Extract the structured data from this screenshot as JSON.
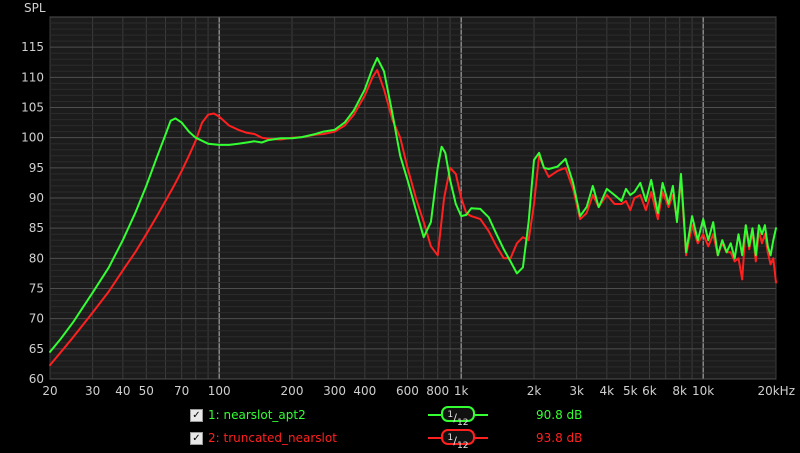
{
  "chart_data": {
    "type": "line",
    "ylabel": "SPL",
    "xlabel": "",
    "x_scale": "log",
    "xlim": [
      20,
      20000
    ],
    "ylim": [
      60,
      120
    ],
    "grid": true,
    "x_ticks": [
      {
        "value": 20,
        "label": "20"
      },
      {
        "value": 30,
        "label": "30"
      },
      {
        "value": 40,
        "label": "40"
      },
      {
        "value": 50,
        "label": "50"
      },
      {
        "value": 70,
        "label": "70"
      },
      {
        "value": 100,
        "label": "100"
      },
      {
        "value": 200,
        "label": "200"
      },
      {
        "value": 300,
        "label": "300"
      },
      {
        "value": 400,
        "label": "400"
      },
      {
        "value": 600,
        "label": "600"
      },
      {
        "value": 800,
        "label": "800"
      },
      {
        "value": 1000,
        "label": "1k"
      },
      {
        "value": 2000,
        "label": "2k"
      },
      {
        "value": 3000,
        "label": "3k"
      },
      {
        "value": 4000,
        "label": "4k"
      },
      {
        "value": 5000,
        "label": "5k"
      },
      {
        "value": 6000,
        "label": "6k"
      },
      {
        "value": 8000,
        "label": "8k"
      },
      {
        "value": 10000,
        "label": "10k"
      },
      {
        "value": 20000,
        "label": "20kHz"
      }
    ],
    "y_ticks": [
      60,
      65,
      70,
      75,
      80,
      85,
      90,
      95,
      100,
      105,
      110,
      115
    ],
    "series": [
      {
        "name": "1: nearslot_apt2",
        "color": "#33ff33",
        "x": [
          20,
          22,
          25,
          28,
          30,
          35,
          40,
          45,
          50,
          55,
          60,
          63,
          66,
          70,
          75,
          80,
          90,
          100,
          110,
          120,
          130,
          140,
          150,
          160,
          180,
          200,
          220,
          250,
          270,
          300,
          330,
          360,
          400,
          430,
          450,
          480,
          520,
          560,
          600,
          650,
          700,
          750,
          800,
          830,
          860,
          900,
          950,
          1000,
          1050,
          1100,
          1200,
          1300,
          1400,
          1500,
          1600,
          1700,
          1800,
          1900,
          2000,
          2100,
          2200,
          2300,
          2500,
          2700,
          2900,
          3100,
          3300,
          3500,
          3700,
          4000,
          4300,
          4600,
          4800,
          5000,
          5200,
          5500,
          5800,
          6100,
          6500,
          6800,
          7200,
          7500,
          7800,
          8100,
          8500,
          9000,
          9500,
          10000,
          10500,
          11000,
          11500,
          12000,
          12500,
          13000,
          13500,
          14000,
          14500,
          15000,
          15500,
          16000,
          16500,
          17000,
          17500,
          18000,
          18500,
          19000,
          19500,
          20000
        ],
        "y": [
          64.5,
          66.5,
          69.5,
          72.5,
          74.3,
          78.5,
          83,
          87.5,
          92,
          96.5,
          100.5,
          102.8,
          103.2,
          102.5,
          101,
          100,
          99,
          98.8,
          98.8,
          99,
          99.2,
          99.4,
          99.2,
          99.6,
          99.9,
          99.9,
          100.1,
          100.6,
          101,
          101.3,
          102.5,
          104.5,
          108,
          111.5,
          113.2,
          111,
          104,
          97,
          93,
          88,
          83.5,
          86,
          95,
          98.5,
          97.5,
          93,
          89,
          87,
          87.2,
          88.3,
          88.2,
          86.8,
          84,
          81.5,
          79.5,
          77.5,
          78.5,
          86,
          96.3,
          97.5,
          95,
          94.8,
          95.2,
          96.5,
          92.5,
          87,
          88.5,
          92,
          88.5,
          91.5,
          90.5,
          89.5,
          91.5,
          90.5,
          91,
          92.5,
          89.5,
          93,
          87.5,
          92.5,
          89,
          92,
          86,
          94,
          81,
          87,
          83,
          86.5,
          83,
          86,
          80.5,
          83,
          81,
          82.5,
          80,
          84,
          80.5,
          85.5,
          82,
          85,
          80.5,
          85.5,
          84,
          85.5,
          82,
          80.5,
          83,
          85
        ]
      },
      {
        "name": "2: truncated_nearslot",
        "color": "#ff2020",
        "x": [
          20,
          22,
          25,
          28,
          30,
          35,
          40,
          45,
          50,
          55,
          60,
          65,
          70,
          75,
          80,
          85,
          90,
          95,
          100,
          110,
          120,
          130,
          140,
          150,
          160,
          180,
          200,
          220,
          250,
          270,
          300,
          330,
          360,
          400,
          430,
          450,
          480,
          520,
          560,
          600,
          650,
          700,
          750,
          800,
          850,
          900,
          950,
          1000,
          1050,
          1100,
          1200,
          1300,
          1400,
          1500,
          1600,
          1700,
          1800,
          1900,
          2000,
          2100,
          2200,
          2300,
          2500,
          2700,
          2900,
          3100,
          3300,
          3500,
          3700,
          4000,
          4300,
          4600,
          4800,
          5000,
          5200,
          5500,
          5800,
          6100,
          6500,
          6800,
          7200,
          7500,
          7800,
          8100,
          8500,
          9000,
          9500,
          10000,
          10500,
          11000,
          11500,
          12000,
          12500,
          13000,
          13500,
          14000,
          14500,
          15000,
          15500,
          16000,
          16500,
          17000,
          17500,
          18000,
          18500,
          19000,
          19500,
          20000
        ],
        "y": [
          62.3,
          64.3,
          67,
          69.5,
          71,
          74.5,
          78,
          81,
          84,
          86.8,
          89.5,
          92,
          94.5,
          97,
          99.5,
          102.5,
          103.8,
          104,
          103.5,
          102,
          101.3,
          100.8,
          100.6,
          100,
          99.8,
          99.7,
          100,
          100.1,
          100.5,
          100.6,
          101,
          102,
          103.8,
          107,
          110,
          111.2,
          108,
          103,
          100,
          95,
          90,
          86,
          82,
          80.5,
          90,
          95,
          94,
          90,
          87.5,
          87,
          86.5,
          84.5,
          82,
          80,
          80,
          82.5,
          83.5,
          83,
          89,
          97,
          95,
          93.5,
          94.5,
          95,
          91.5,
          86.5,
          87.5,
          90.5,
          88.5,
          90.5,
          89,
          89,
          89.5,
          88,
          90,
          90.5,
          88,
          91,
          86.5,
          91,
          88.5,
          90.5,
          86.5,
          93,
          80.5,
          85.5,
          82.5,
          84,
          82,
          84,
          80.5,
          82.5,
          81,
          81,
          79.5,
          80,
          76.5,
          85.5,
          81.5,
          84.5,
          79.5,
          84.5,
          82.5,
          84,
          81,
          79,
          80,
          76
        ]
      }
    ]
  },
  "legend": {
    "rows": [
      {
        "checkbox": "✓",
        "label": "1: nearslot_apt2",
        "smoothing_num": "1",
        "smoothing_den": "12",
        "spl": "90.8 dB",
        "color": "#33ff33"
      },
      {
        "checkbox": "✓",
        "label": "2: truncated_nearslot",
        "smoothing_num": "1",
        "smoothing_den": "12",
        "spl": "93.8 dB",
        "color": "#ff2020"
      }
    ]
  }
}
